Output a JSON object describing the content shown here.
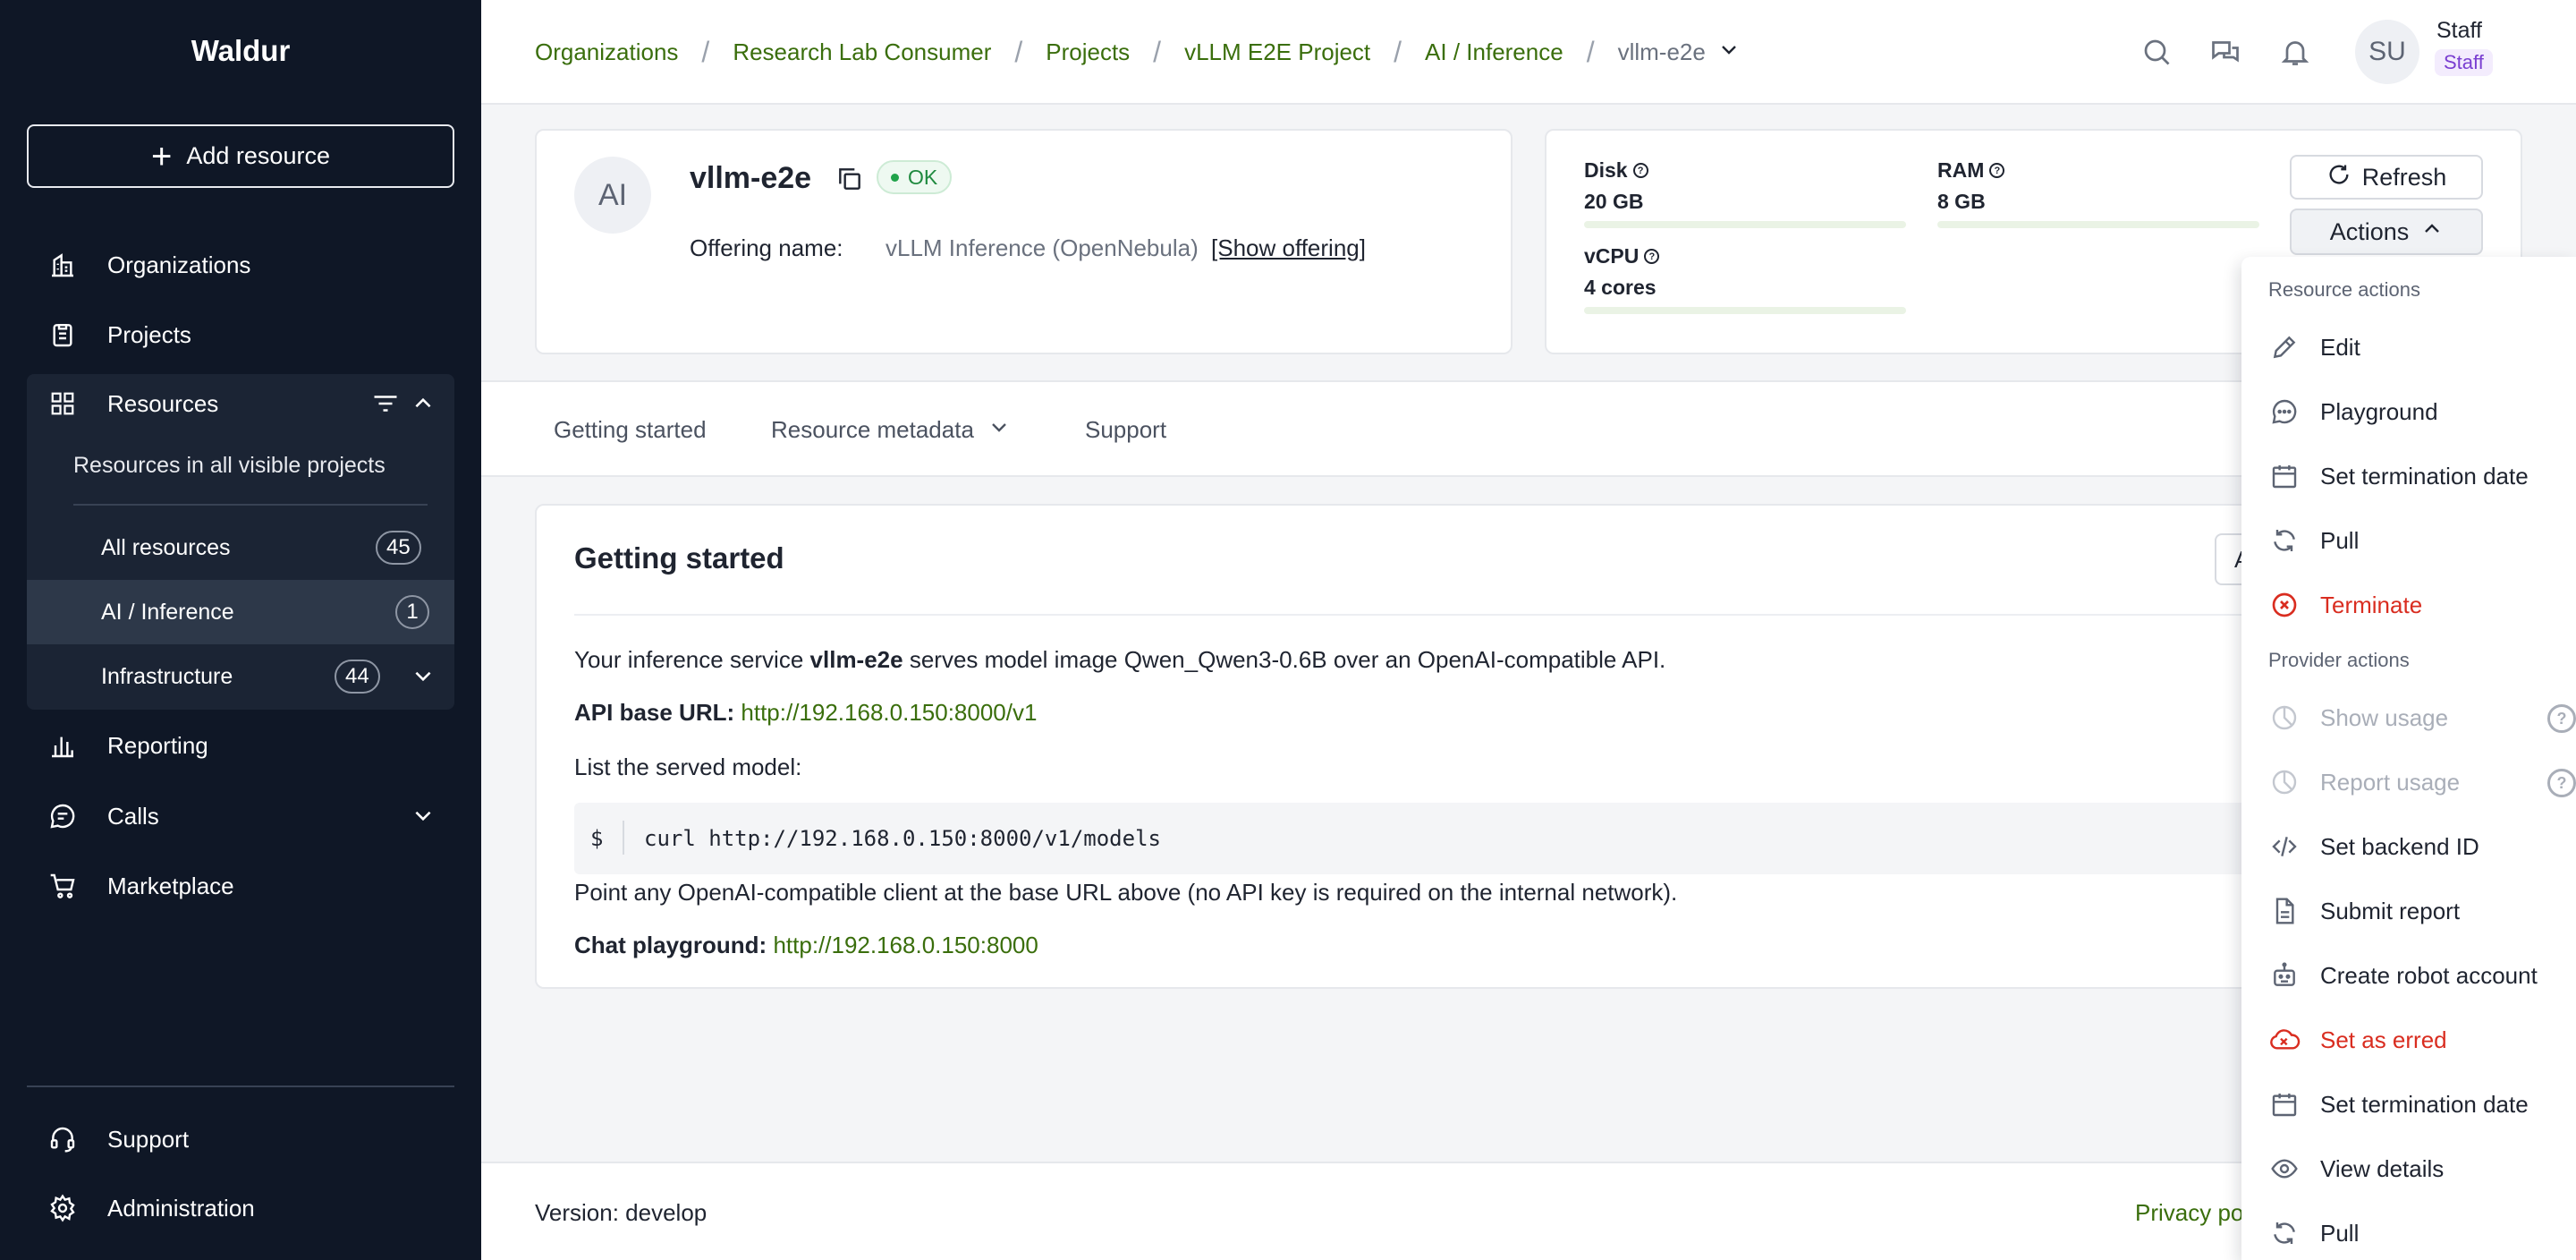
{
  "app": {
    "brand": "Waldur",
    "add_resource": "Add resource"
  },
  "sidebar": {
    "organizations": "Organizations",
    "projects": "Projects",
    "resources": "Resources",
    "resources_all_visible": "Resources in all visible projects",
    "sub_items": [
      {
        "label": "All resources",
        "count": "45"
      },
      {
        "label": "AI / Inference",
        "count": "1"
      },
      {
        "label": "Infrastructure",
        "count": "44"
      }
    ],
    "reporting": "Reporting",
    "calls": "Calls",
    "marketplace": "Marketplace",
    "support": "Support",
    "administration": "Administration"
  },
  "breadcrumbs": {
    "items": [
      "Organizations",
      "Research Lab Consumer",
      "Projects",
      "vLLM E2E Project",
      "AI / Inference"
    ],
    "current": "vllm-e2e"
  },
  "user": {
    "initials": "SU",
    "name": "Staff",
    "role": "Staff"
  },
  "resource": {
    "initials": "AI",
    "name": "vllm-e2e",
    "status": "OK",
    "offering_label": "Offering name:",
    "offering_value": "vLLM Inference (OpenNebula)",
    "show_offering": "[Show offering]"
  },
  "quotas": {
    "disk": {
      "label": "Disk",
      "value": "20 GB"
    },
    "ram": {
      "label": "RAM",
      "value": "8 GB"
    },
    "vcpu": {
      "label": "vCPU",
      "value": "4 cores"
    }
  },
  "buttons": {
    "refresh": "Refresh",
    "actions": "Actions"
  },
  "tabs": [
    "Getting started",
    "Resource metadata",
    "Support"
  ],
  "getting_started": {
    "title": "Getting started",
    "hidden_button": "A",
    "intro_pre": "Your inference service ",
    "intro_bold": "vllm-e2e",
    "intro_post": " serves model image Qwen_Qwen3-0.6B over an OpenAI-compatible API.",
    "api_label": "API base URL:",
    "api_url": "http://192.168.0.150:8000/v1",
    "list_label": "List the served model:",
    "code_prompt": "$",
    "code_cmd": "curl http://192.168.0.150:8000/v1/models",
    "point_text": "Point any OpenAI-compatible client at the base URL above (no API key is required on the internal network).",
    "chat_label": "Chat playground:",
    "chat_url": "http://192.168.0.150:8000"
  },
  "footer": {
    "version": "Version: develop",
    "privacy": "Privacy po"
  },
  "dropdown": {
    "resource_actions_header": "Resource actions",
    "resource_actions": [
      {
        "label": "Edit",
        "icon": "pencil-icon"
      },
      {
        "label": "Playground",
        "icon": "chat-bubble-icon"
      },
      {
        "label": "Set termination date",
        "icon": "calendar-icon"
      },
      {
        "label": "Pull",
        "icon": "refresh-icon"
      },
      {
        "label": "Terminate",
        "icon": "x-circle-icon"
      }
    ],
    "provider_actions_header": "Provider actions",
    "provider_actions": [
      {
        "label": "Show usage",
        "icon": "chart-pie-icon"
      },
      {
        "label": "Report usage",
        "icon": "chart-pie-icon"
      },
      {
        "label": "Set backend ID",
        "icon": "code-icon"
      },
      {
        "label": "Submit report",
        "icon": "file-icon"
      },
      {
        "label": "Create robot account",
        "icon": "robot-icon"
      },
      {
        "label": "Set as erred",
        "icon": "cloud-x-icon"
      },
      {
        "label": "Set termination date",
        "icon": "calendar-icon"
      },
      {
        "label": "View details",
        "icon": "eye-icon"
      },
      {
        "label": "Pull",
        "icon": "refresh-icon"
      }
    ]
  },
  "colors": {
    "sidebar_bg": "#0f1726",
    "link_green": "#3a6e0c",
    "danger_red": "#d92d20",
    "ok_green": "#1f8a3f"
  }
}
